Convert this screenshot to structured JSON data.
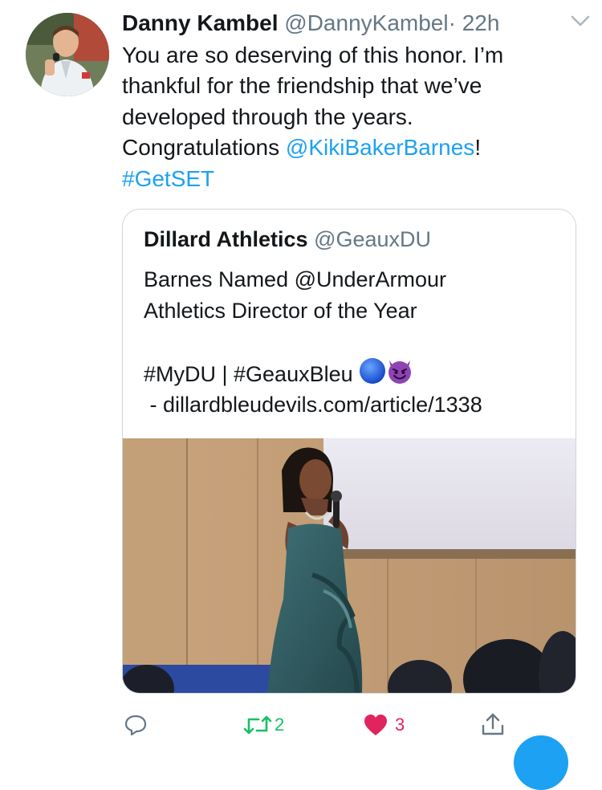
{
  "tweet": {
    "author_name": "Danny Kambel",
    "author_handle": "@DannyKambel",
    "separator": "·",
    "time": "22h",
    "text_line1": "You are so deserving of this honor. I’m",
    "text_line2": "thankful for the friendship that we’ve",
    "text_line3": "developed through the years.",
    "text_line4_prefix": "Congratulations ",
    "mention": "@KikiBakerBarnes",
    "text_line4_suffix": "!",
    "hashtag": "#GetSET"
  },
  "quoted_tweet": {
    "author_name": "Dillard Athletics",
    "author_handle": "@GeauxDU",
    "line1": "Barnes Named @UnderArmour",
    "line2": "Athletics Director of the Year",
    "line3": "#MyDU | #GeauxBleu",
    "line4": " - dillardbleudevils.com/article/1338",
    "emoji1": "blue-circle-emoji",
    "emoji2": "smiling-imp-emoji"
  },
  "actions": {
    "retweet_count": "2",
    "like_count": "3",
    "retweet_color": "#17bf63",
    "like_color": "#e0245e",
    "icon_color": "#657786"
  },
  "colors": {
    "link": "#1da1f2",
    "border": "#ccd6dd",
    "secondary_text": "#657786"
  }
}
